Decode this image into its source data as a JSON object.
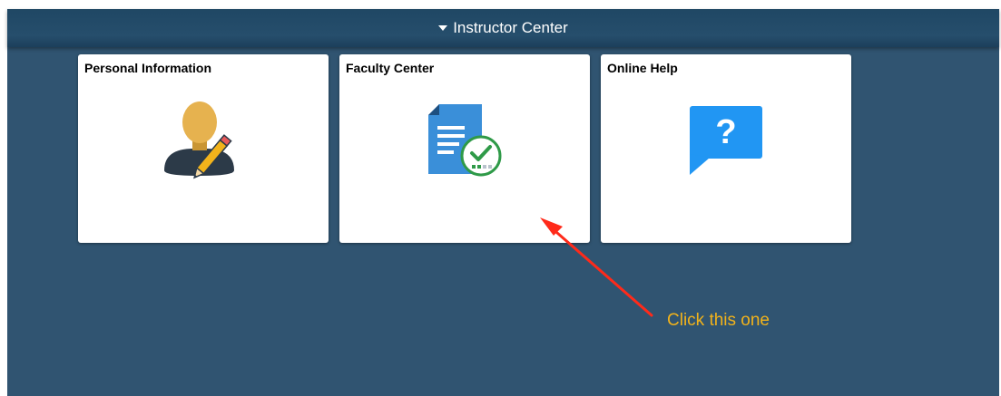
{
  "header": {
    "title": "Instructor Center",
    "caret_icon": "caret-down-icon"
  },
  "tiles": [
    {
      "title": "Personal Information",
      "icon": "user-edit-icon"
    },
    {
      "title": "Faculty Center",
      "icon": "document-check-icon"
    },
    {
      "title": "Online Help",
      "icon": "help-bubble-icon"
    }
  ],
  "annotation": {
    "text": "Click this one",
    "color": "#f2b31b",
    "arrow_color": "#ff2a1a"
  },
  "colors": {
    "background": "#305471",
    "header": "#264e6c",
    "tile": "#ffffff"
  }
}
